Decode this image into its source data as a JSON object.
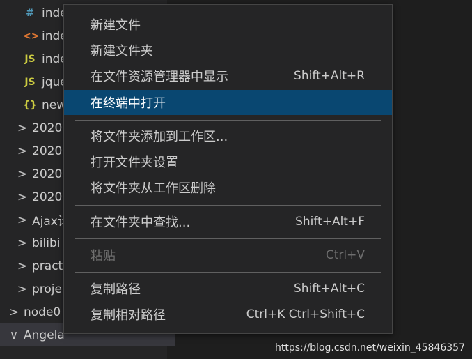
{
  "explorer": {
    "items": [
      {
        "label": "inde",
        "icon": "#",
        "icon_name": "css-file-icon",
        "color": "#519aba"
      },
      {
        "label": "inde",
        "icon": "<>",
        "icon_name": "html-file-icon",
        "color": "#e37933"
      },
      {
        "label": "inde",
        "icon": "JS",
        "icon_name": "js-file-icon",
        "color": "#cbcb41"
      },
      {
        "label": "jque",
        "icon": "JS",
        "icon_name": "js-file-icon",
        "color": "#cbcb41"
      },
      {
        "label": "new",
        "icon": "{}",
        "icon_name": "json-file-icon",
        "color": "#cbcb41"
      },
      {
        "label": "2020",
        "chevron": ">"
      },
      {
        "label": "2020",
        "chevron": ">"
      },
      {
        "label": "2020",
        "chevron": ">"
      },
      {
        "label": "2020",
        "chevron": ">"
      },
      {
        "label": "Ajax计",
        "chevron": ">"
      },
      {
        "label": "bilibi",
        "chevron": ">"
      },
      {
        "label": "pract",
        "chevron": ">"
      },
      {
        "label": "proje",
        "chevron": ">"
      },
      {
        "label": "node0",
        "chevron": ">"
      },
      {
        "label": "Angela",
        "chevron": "∨"
      }
    ]
  },
  "context_menu": {
    "new_file": "新建文件",
    "new_folder": "新建文件夹",
    "reveal_in_explorer": "在文件资源管理器中显示",
    "reveal_shortcut": "Shift+Alt+R",
    "open_in_terminal": "在终端中打开",
    "add_folder_to_workspace": "将文件夹添加到工作区...",
    "open_folder_settings": "打开文件夹设置",
    "remove_from_workspace": "将文件夹从工作区删除",
    "find_in_folder": "在文件夹中查找...",
    "find_shortcut": "Shift+Alt+F",
    "paste": "粘贴",
    "paste_shortcut": "Ctrl+V",
    "copy_path": "复制路径",
    "copy_path_shortcut": "Shift+Alt+C",
    "copy_relative_path": "复制相对路径",
    "copy_relative_path_shortcut": "Ctrl+K Ctrl+Shift+C"
  },
  "watermark": "https://blog.csdn.net/weixin_45846357",
  "colors": {
    "highlight": "#094771",
    "menu_bg": "#252526",
    "editor_bg": "#1e1e1e"
  }
}
